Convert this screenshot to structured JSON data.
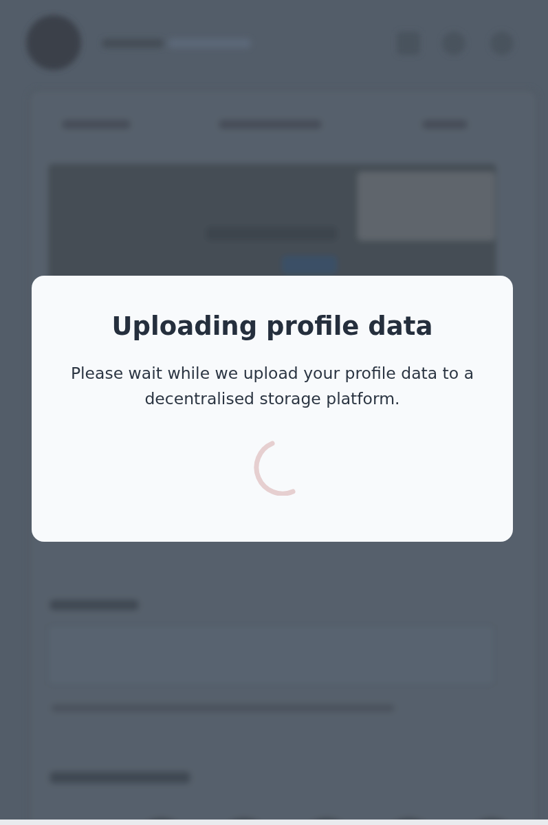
{
  "modal": {
    "title": "Uploading profile data",
    "message": "Please wait while we upload your profile data to a decentralised storage platform."
  }
}
